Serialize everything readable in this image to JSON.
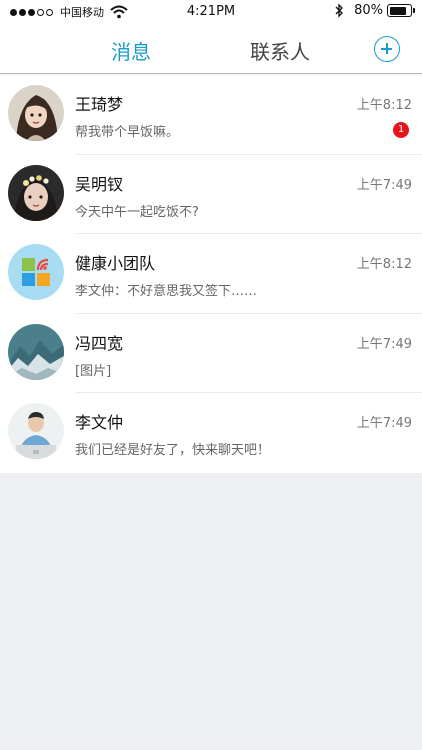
{
  "status_bar": {
    "carrier": "中国移动",
    "time": "4:21PM",
    "battery": "80%"
  },
  "header": {
    "tab_messages": "消息",
    "tab_contacts": "联系人",
    "active_color": "#1a9bd0"
  },
  "conversations": [
    {
      "name": "王琦梦",
      "time": "上午8:12",
      "preview": "帮我带个早饭嘛。",
      "badge": "1",
      "avatar": "girl-portrait-avatar"
    },
    {
      "name": "吴明钗",
      "time": "上午7:49",
      "preview": "今天中午一起吃饭不?",
      "avatar": "girl-flower-crown-avatar"
    },
    {
      "name": "健康小团队",
      "time": "上午8:12",
      "preview": "李文仲：不好意思我又签下……",
      "avatar": "group-tiles-avatar"
    },
    {
      "name": "冯四宽",
      "time": "上午7:49",
      "preview": "[图片]",
      "avatar": "mountain-landscape-avatar"
    },
    {
      "name": "李文仲",
      "time": "上午7:49",
      "preview": "我们已经是好友了，快来聊天吧！",
      "avatar": "man-laptop-avatar"
    }
  ]
}
